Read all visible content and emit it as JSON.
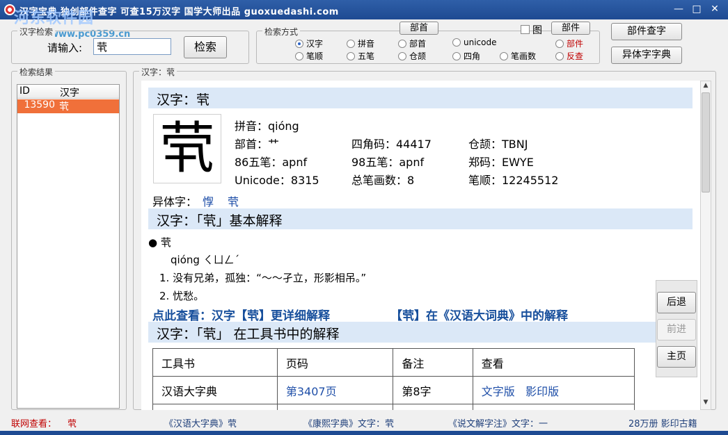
{
  "titlebar": {
    "title": "汉字宝典  独创部件查字  可查15万汉字  国学大师出品 guoxuedashi.com",
    "watermark": "河东软件园",
    "watermark_url": "www.pc0359.cn",
    "min_icon": "minimize-icon",
    "max_icon": "maximize-icon",
    "close_icon": "close-icon"
  },
  "search_group": {
    "legend": "汉字检索",
    "input_label": "请输入:",
    "input_value": "茕",
    "search_button": "检索"
  },
  "method_group": {
    "legend": "检索方式",
    "radical_button": "部首",
    "image_checkbox_label": "图",
    "component_button": "部件",
    "options": [
      {
        "label": "汉字",
        "selected": true,
        "red": false
      },
      {
        "label": "拼音",
        "selected": false,
        "red": false
      },
      {
        "label": "部首",
        "selected": false,
        "red": false
      },
      {
        "label": "unicode",
        "selected": false,
        "red": false
      },
      {
        "label": "部件",
        "selected": false,
        "red": true
      },
      {
        "label": "笔顺",
        "selected": false,
        "red": false
      },
      {
        "label": "五笔",
        "selected": false,
        "red": false
      },
      {
        "label": "仓颉",
        "selected": false,
        "red": false
      },
      {
        "label": "四角",
        "selected": false,
        "red": false
      },
      {
        "label": "笔画数",
        "selected": false,
        "red": false
      },
      {
        "label": "反查",
        "selected": false,
        "red": true
      }
    ]
  },
  "right_buttons": {
    "component_lookup": "部件查字",
    "variant_dict": "异体字字典"
  },
  "results": {
    "legend": "检索结果",
    "columns": [
      "ID",
      "汉字"
    ],
    "rows": [
      {
        "id": "13590",
        "char": "茕"
      }
    ]
  },
  "detail": {
    "legend": "汉字：茕",
    "sec1_title": "汉字：茕",
    "big_char": "茕",
    "fields": {
      "pinyin": "拼音：qióng",
      "radical": "部首：艹",
      "sijiao": "四角码：44417",
      "cangjie": "仓颉：TBNJ",
      "wubi86": "86五笔：apnf",
      "wubi98": "98五笔：apnf",
      "zhengma": "郑码：EWYE",
      "unicode": "Unicode：8315",
      "strokes": "总笔画数：8",
      "stroke_order": "笔顺：12245512"
    },
    "variants_label": "异体字：",
    "variants": [
      "惸",
      "茕"
    ],
    "sec2_title": "汉字：「茕」基本解释",
    "entry_head": "● 茕",
    "entry_pron": "qióng ㄑㄩㄥˊ",
    "def1": "1. 没有兄弟，孤独：“～～孑立，形影相吊。”",
    "def2": "2. 忧愁。",
    "more_link": "点此查看：汉字【茕】更详细解释",
    "big_dict_link": "【茕】在《汉语大词典》中的解释",
    "sec3_title": "汉字：「茕」 在工具书中的解释",
    "table_headers": [
      "工具书",
      "页码",
      "备注",
      "查看"
    ],
    "table_rows": [
      {
        "book": "汉语大字典",
        "page": "第3407页",
        "note": "第8字",
        "view1": "文字版",
        "view2": "影印版"
      }
    ]
  },
  "nav": {
    "back": "后退",
    "forward": "前进",
    "home": "主页"
  },
  "statusbar": {
    "online": "联网查看：",
    "online_char": "茕",
    "s1": "《汉语大字典》茕",
    "s2": "《康熙字典》文字：茕",
    "s3": "《说文解字注》文字：一",
    "s4": "28万册  影印古籍"
  },
  "colors": {
    "selection": "#f0703a",
    "section_bg": "#dbe8f7",
    "link": "#1f4fa8",
    "red": "#c00000"
  }
}
